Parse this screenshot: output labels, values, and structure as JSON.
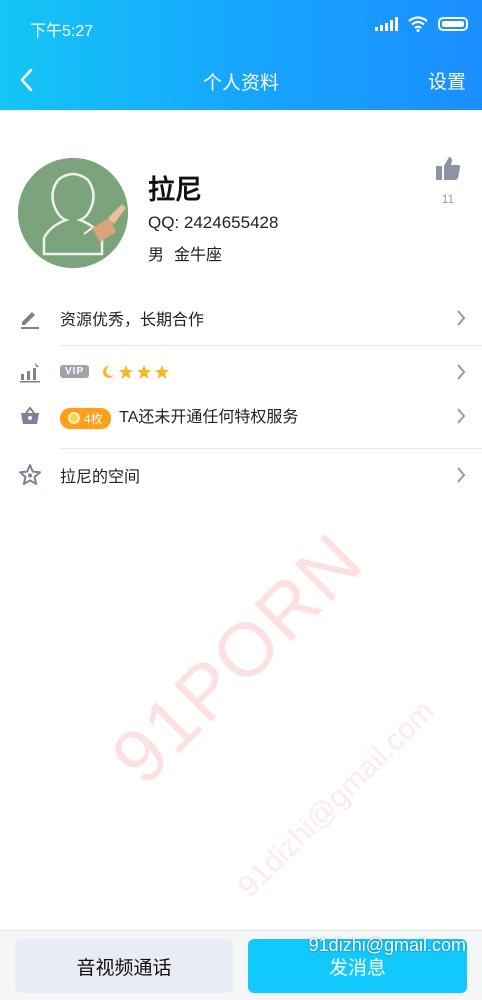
{
  "status_bar": {
    "time": "下午5:27"
  },
  "nav": {
    "title": "个人资料",
    "settings_label": "设置"
  },
  "profile": {
    "name": "拉尼",
    "qq": "QQ: 2424655428",
    "gender": "男",
    "zodiac": "金牛座",
    "like_count": "11"
  },
  "rows": {
    "signature": "资源优秀，长期合作",
    "vip_label": "VIP",
    "coins_badge": "4枚",
    "privilege_text": "TA还未开通任何特权服务",
    "space_label": "拉尼的空间"
  },
  "watermark": {
    "brand": "91PORN",
    "email": "91dizhi@gmail.com"
  },
  "bottom_bar": {
    "call_label": "音视频通话",
    "message_label": "发消息",
    "overlay_email": "91dizhi@gmail.com"
  },
  "colors": {
    "header_start": "#14c6f5",
    "header_end": "#1a8eff",
    "message_button": "#11c8ff",
    "coin_badge": "#ff9f1a"
  }
}
